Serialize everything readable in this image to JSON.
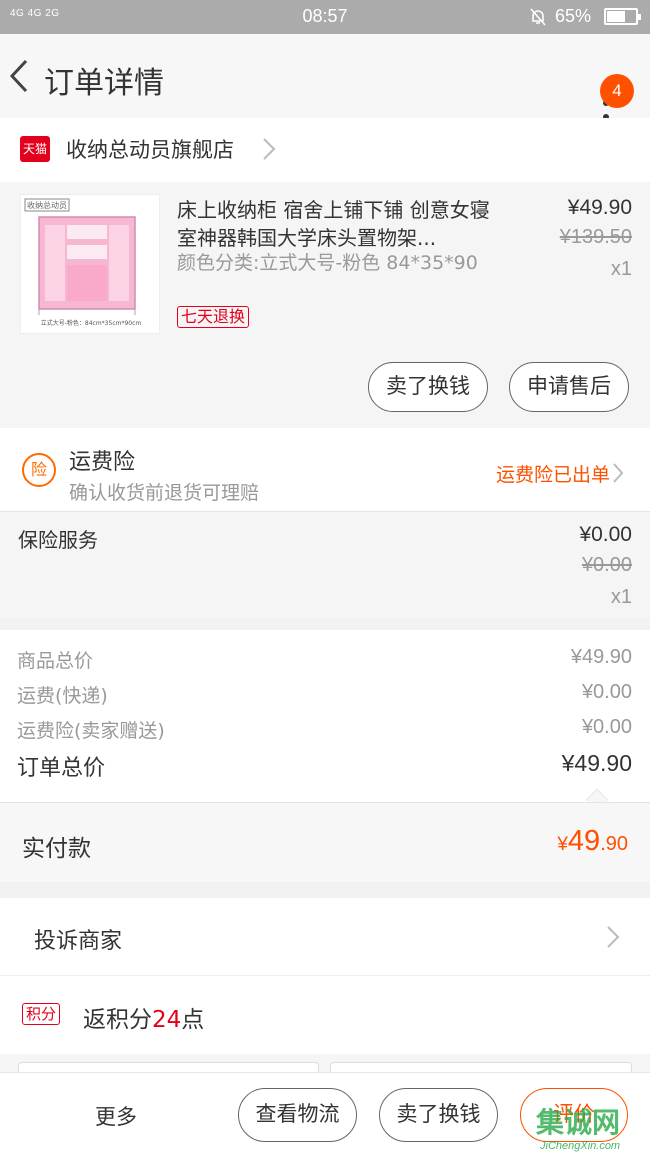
{
  "status_bar": {
    "network": "4G 4G 2G",
    "time": "08:57",
    "battery_percent": "65%",
    "battery_level": 0.65
  },
  "header": {
    "title": "订单详情",
    "more_badge": "4"
  },
  "shop": {
    "badge": "天猫",
    "name": "收纳总动员旗舰店"
  },
  "product": {
    "title": "床上收纳柜 宿舍上铺下铺 创意女寝室神器韩国大学床头置物架...",
    "spec": "颜色分类:立式大号-粉色 84*35*90",
    "return_tag": "七天退换",
    "price": "¥49.90",
    "original_price": "¥139.50",
    "quantity": "x1",
    "thumb_logo": "收纳总动员",
    "thumb_caption": "立式大号-粉色：84cm*35cm*90cm",
    "actions": [
      {
        "label": "卖了换钱"
      },
      {
        "label": "申请售后"
      }
    ]
  },
  "freight_insurance": {
    "icon_text": "险",
    "title": "运费险",
    "subtitle": "确认收货前退货可理赔",
    "status": "运费险已出单"
  },
  "insurance_service": {
    "label": "保险服务",
    "price": "¥0.00",
    "original_price": "¥0.00",
    "quantity": "x1"
  },
  "summary": {
    "rows": [
      {
        "label": "商品总价",
        "value": "¥49.90"
      },
      {
        "label": "运费(快递)",
        "value": "¥0.00"
      },
      {
        "label": "运费险(卖家赠送)",
        "value": "¥0.00"
      }
    ],
    "total_label": "订单总价",
    "total_value": "¥49.90"
  },
  "payment": {
    "label": "实付款",
    "currency": "¥",
    "integer": "49",
    "decimal": ".90"
  },
  "complaint": {
    "label": "投诉商家"
  },
  "points": {
    "tag": "积分",
    "prefix": "返积分",
    "number": "24",
    "suffix": "点"
  },
  "bottom_bar": {
    "more": "更多",
    "buttons": [
      {
        "label": "查看物流"
      },
      {
        "label": "卖了换钱"
      },
      {
        "label": "评价"
      }
    ]
  },
  "watermark": {
    "text": "集诚网",
    "url": "JiChengXin.com"
  },
  "colors": {
    "accent": "#ff5000",
    "tmall_red": "#e4001d",
    "status_bar": "#ababab"
  }
}
